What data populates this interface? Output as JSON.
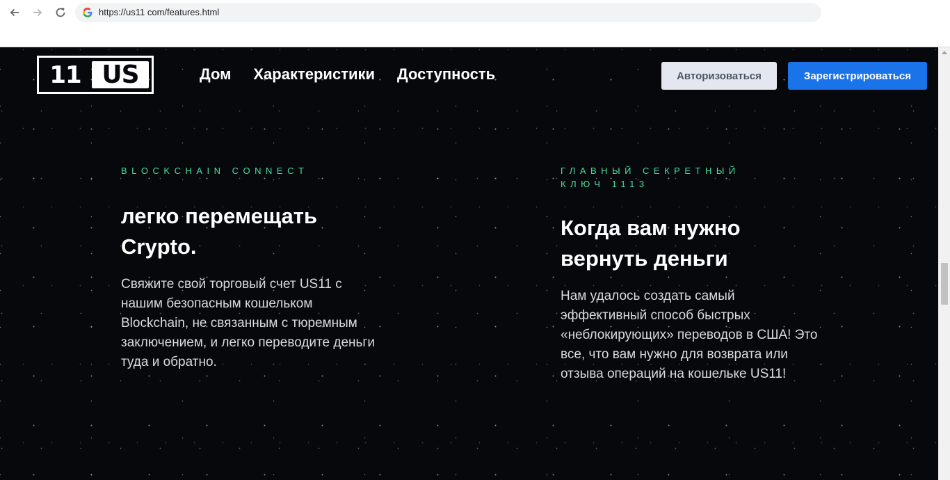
{
  "browser": {
    "url": "https://us11 com/features.html",
    "back_icon": "back-arrow-icon",
    "forward_icon": "forward-arrow-icon",
    "reload_icon": "reload-icon",
    "site_icon": "google-g-icon"
  },
  "header": {
    "logo_left": "11",
    "logo_right": "US",
    "nav": [
      {
        "label": "Дом"
      },
      {
        "label": "Характеристики"
      },
      {
        "label": "Доступность"
      }
    ],
    "login_label": "Авторизоваться",
    "register_label": "Зарегистрироваться"
  },
  "features": [
    {
      "eyebrow": "BLOCKCHAIN CONNECT",
      "heading": "легко перемещать Crypto.",
      "body": "Свяжите свой торговый счет US11 с нашим безопасным кошельком Blockchain, не связанным с тюремным заключением, и легко переводите деньги туда и обратно."
    },
    {
      "eyebrow": "ГЛАВНЫЙ СЕКРЕТНЫЙ КЛЮЧ 1113",
      "heading": "Когда вам нужно вернуть деньги",
      "body": "Нам удалось создать самый эффективный способ быстрых «неблокирующих» переводов в США! Это все, что вам нужно для возврата или отзыва операций на кошельке US11!"
    }
  ],
  "colors": {
    "page_background": "#06080c",
    "eyebrow": "#4ade9b",
    "register_button": "#1a73e8",
    "login_button": "#e4e7ef"
  }
}
